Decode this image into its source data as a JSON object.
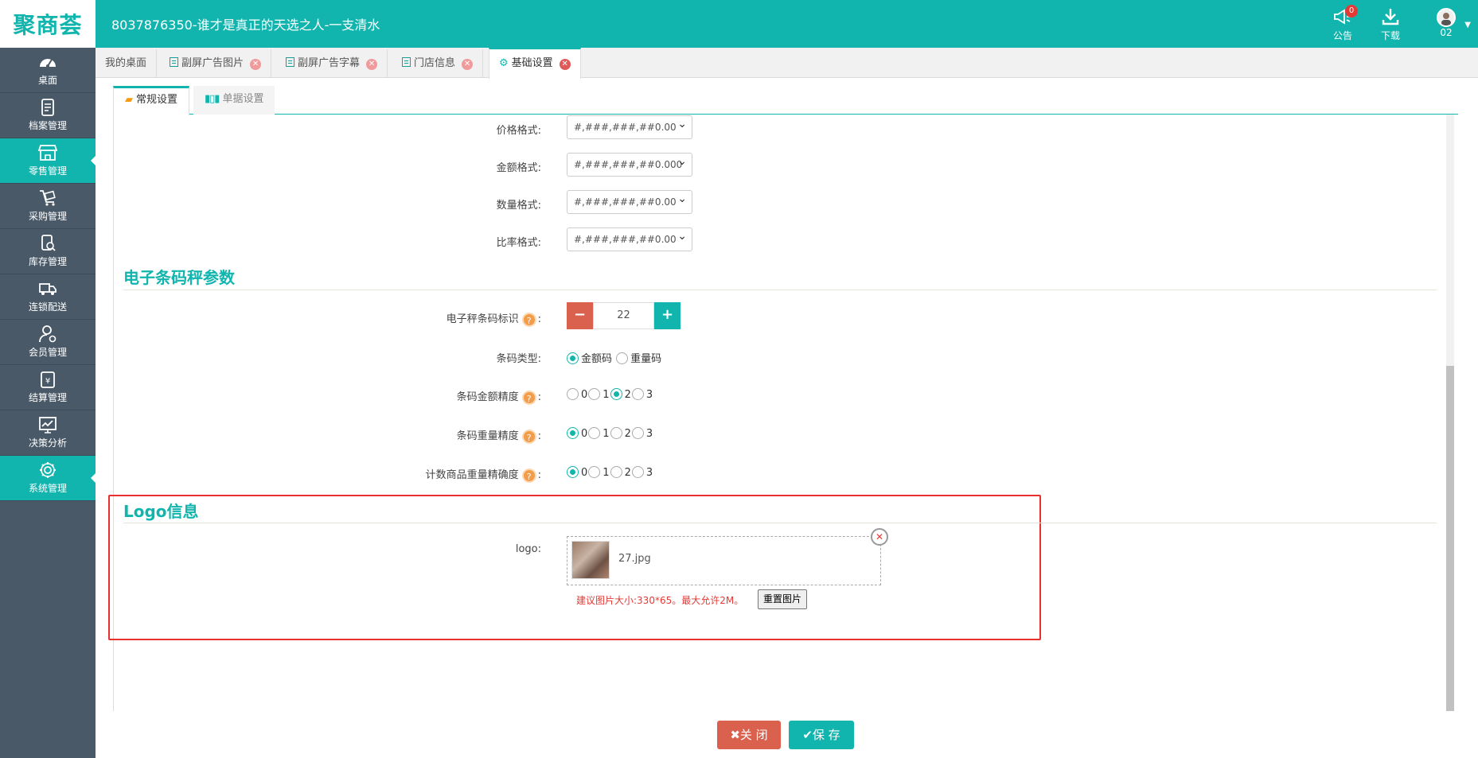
{
  "header": {
    "logo": "聚商荟",
    "title": "8037876350-谁才是真正的天选之人-一支清水",
    "notice_label": "公告",
    "notice_count": "0",
    "download_label": "下载",
    "user_label": "02"
  },
  "sidebar": {
    "items": [
      {
        "label": "桌面",
        "icon": "dashboard-icon"
      },
      {
        "label": "档案管理",
        "icon": "archive-icon"
      },
      {
        "label": "零售管理",
        "icon": "store-icon",
        "active": true
      },
      {
        "label": "采购管理",
        "icon": "cart-icon"
      },
      {
        "label": "库存管理",
        "icon": "inventory-icon"
      },
      {
        "label": "连锁配送",
        "icon": "truck-icon"
      },
      {
        "label": "会员管理",
        "icon": "member-icon"
      },
      {
        "label": "结算管理",
        "icon": "settlement-icon"
      },
      {
        "label": "决策分析",
        "icon": "chart-icon"
      },
      {
        "label": "系统管理",
        "icon": "gear-icon",
        "active": true
      }
    ]
  },
  "tabs": [
    {
      "label": "我的桌面"
    },
    {
      "label": "副屏广告图片"
    },
    {
      "label": "副屏广告字幕"
    },
    {
      "label": "门店信息"
    },
    {
      "label": "基础设置",
      "active": true
    }
  ],
  "subtabs": [
    {
      "label": "常规设置",
      "active": true
    },
    {
      "label": "单据设置"
    }
  ],
  "formats": [
    {
      "label": "价格格式:",
      "value": "#,###,###,##0.00"
    },
    {
      "label": "金额格式:",
      "value": "#,###,###,##0.000"
    },
    {
      "label": "数量格式:",
      "value": "#,###,###,##0.00"
    },
    {
      "label": "比率格式:",
      "value": "#,###,###,##0.00"
    }
  ],
  "scale_section": {
    "title": "电子条码秤参数",
    "barcode_flag_label": "电子秤条码标识",
    "barcode_flag_value": "22",
    "help_glyph": "?",
    "colon": ":",
    "barcode_type_label": "条码类型:",
    "barcode_type_options": [
      "金额码",
      "重量码"
    ],
    "barcode_type_selected": "金额码",
    "amount_precision_label": "条码金额精度",
    "amount_precision_selected": "2",
    "weight_precision_label": "条码重量精度",
    "weight_precision_selected": "0",
    "count_weight_label": "计数商品重量精确度",
    "count_weight_selected": "0",
    "precision_options": [
      "0",
      "1",
      "2",
      "3"
    ]
  },
  "logo_section": {
    "title": "Logo信息",
    "logo_label": "logo:",
    "file_name": "27.jpg",
    "hint": "建议图片大小:330*65。最大允许2M。",
    "reset_label": "重置图片"
  },
  "footer": {
    "close_label": "关 闭",
    "save_label": "保 存"
  },
  "colors": {
    "brand": "#12b5ae",
    "sidebar": "#4a5968",
    "danger": "#d9614e",
    "highlight_box": "#e8312f"
  }
}
